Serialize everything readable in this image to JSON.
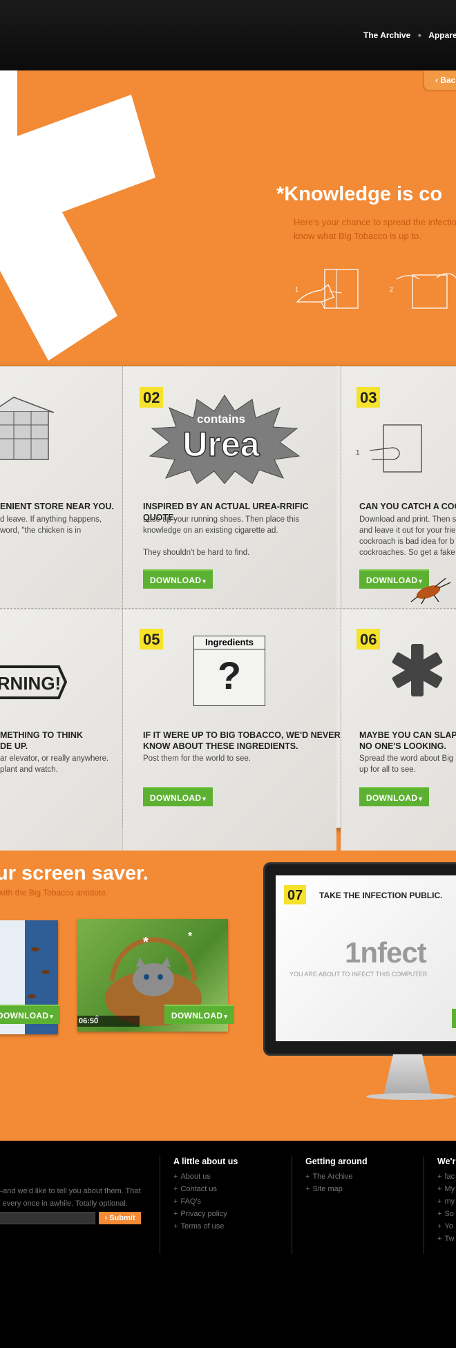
{
  "header": {
    "nav": [
      "The Archive",
      "Appare"
    ]
  },
  "hero": {
    "back_label": "‹ Bac",
    "title": "*Knowledge is co",
    "subtitle_line1": "Here's your chance to spread the infectio",
    "subtitle_line2": "know what Big Tobacco is up to.",
    "sketch_steps": [
      "1",
      "2"
    ]
  },
  "cards": [
    {
      "number": "",
      "title": "ENIENT STORE NEAR YOU.",
      "desc": "d leave. If anything happens,\nword, \"the chicken is in",
      "button": ""
    },
    {
      "number": "02",
      "art_top": "contains",
      "art_main": "Urea",
      "title": "INSPIRED BY AN ACTUAL UREA-RRIFIC QUOTE.",
      "desc": "Lace up your running shoes. Then place this\nknowledge on an existing cigarette ad.\n\nThey shouldn't be hard to find.",
      "button": "DOWNLOAD"
    },
    {
      "number": "03",
      "title": "CAN YOU CATCH A COCK",
      "desc": "Download and print. Then s\nand leave it out for your frie\ncockroach is bad idea for b\ncockroaches. So get a fake",
      "button": "DOWNLOAD",
      "sketch_step": "1"
    },
    {
      "number": "",
      "art_text": "RNING!",
      "title": "METHING TO THINK\nDE UP.",
      "desc": "ar elevator, or really anywhere.\nplant and watch.",
      "button": ""
    },
    {
      "number": "05",
      "art_header": "Ingredients",
      "art_glyph": "?",
      "title": "IF IT WERE UP TO BIG TOBACCO, WE'D NEVER\nKNOW ABOUT THESE INGREDIENTS.",
      "desc": "Post them for the world to see.",
      "button": "DOWNLOAD"
    },
    {
      "number": "06",
      "title": "MAYBE YOU CAN SLAP T\nNO ONE'S LOOKING.",
      "desc": "Spread the word about Big\nup for all to see.",
      "button": "DOWNLOAD"
    }
  ],
  "screensaver": {
    "title": "ur screen saver.",
    "subtitle": "with the Big Tobacco antidote.",
    "button": "DOWNLOAD",
    "timer": "06:50",
    "monitor": {
      "number": "07",
      "title": "TAKE THE INFECTION PUBLIC.",
      "logo": "1nfect",
      "caption": "YOU ARE ABOUT TO INFECT THIS COMPUTER."
    }
  },
  "footer": {
    "intro_line1": "–and we'd like to tell you about them. That",
    "intro_line2": "l every once in awhile. Totally optional.",
    "submit": "› Submit",
    "about": {
      "heading": "A little about us",
      "items": [
        "About us",
        "Contact us",
        "FAQ's",
        "Privacy policy",
        "Terms of use"
      ]
    },
    "around": {
      "heading": "Getting around",
      "items": [
        "The Archive",
        "Site map"
      ]
    },
    "social": {
      "heading": "We'r",
      "items": [
        "fac",
        "My",
        "my",
        "So",
        "Yo",
        "Tw"
      ]
    }
  },
  "colors": {
    "orange": "#f38a35",
    "green": "#5db132",
    "yellow": "#f5e22a"
  }
}
